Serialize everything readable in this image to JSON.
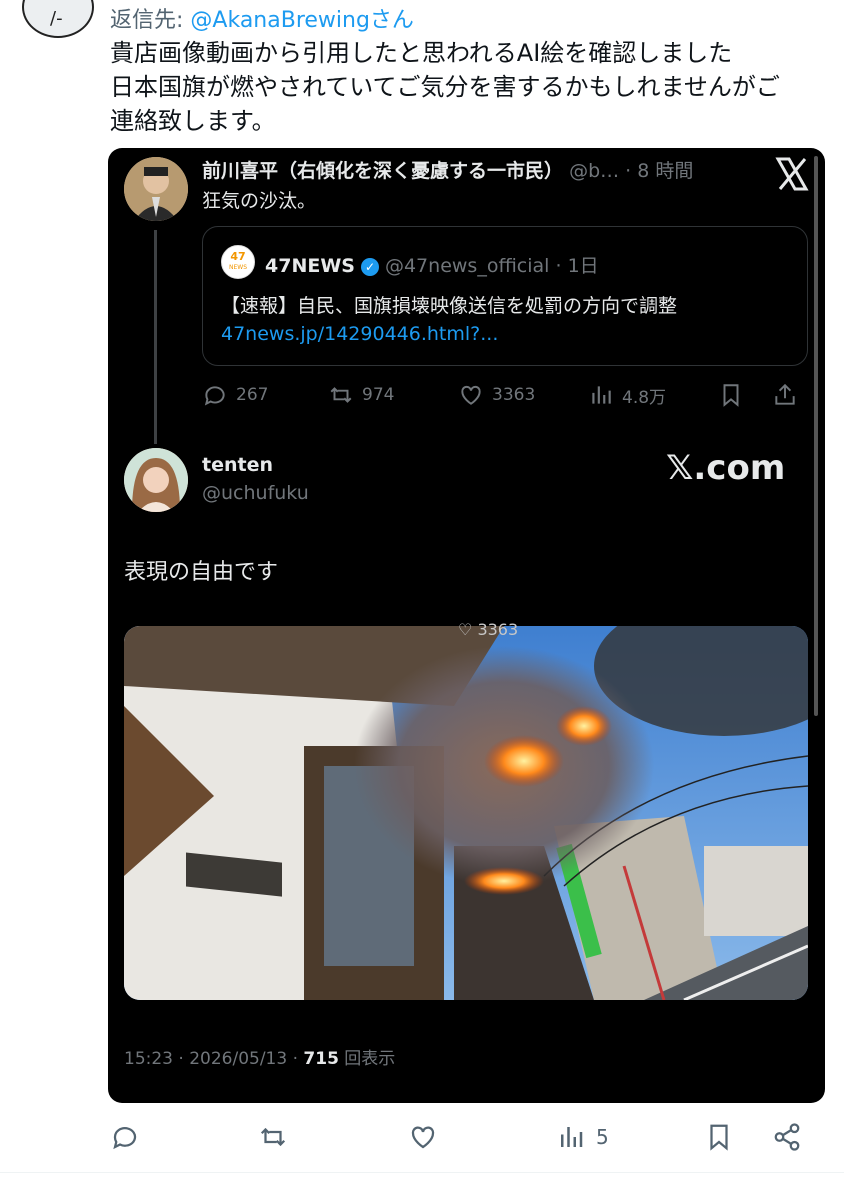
{
  "reply": {
    "prefix": "返信先:",
    "handle": "@AkanaBrewingさん"
  },
  "body": {
    "lines": [
      "貴店画像動画から引用したと思われるAI絵を確認しました",
      "日本国旗が燃やされていてご気分を害するかもしれませんがご",
      "連絡致します。"
    ]
  },
  "embedded": {
    "post1": {
      "name": "前川喜平（右傾化を深く憂慮する一市民）",
      "meta": "@b… · 8 時間",
      "text": "狂気の沙汰。"
    },
    "quote": {
      "logo_top": "47",
      "logo_bottom": "NEWS",
      "name": "47NEWS",
      "meta": "@47news_official · 1日",
      "text": "【速報】自民、国旗損壊映像送信を処罰の方向で調整",
      "link": "47news.jp/14290446.html?..."
    },
    "actions": {
      "replies": "267",
      "reposts": "974",
      "likes": "3363",
      "views": "4.8万"
    },
    "post2": {
      "name": "tenten",
      "handle": "@uchufuku",
      "watermark": "𝕏.com",
      "text": "表現の自由です",
      "photo_overlay_count": "3363",
      "time": "15:23 · 2026/05/13 · ",
      "views": "715",
      "views_label": " 回表示"
    }
  },
  "outer_actions": {
    "views": "5"
  },
  "colors": {
    "link": "#1d9bf0",
    "muted": "#536471",
    "dark_bg": "#000000"
  }
}
